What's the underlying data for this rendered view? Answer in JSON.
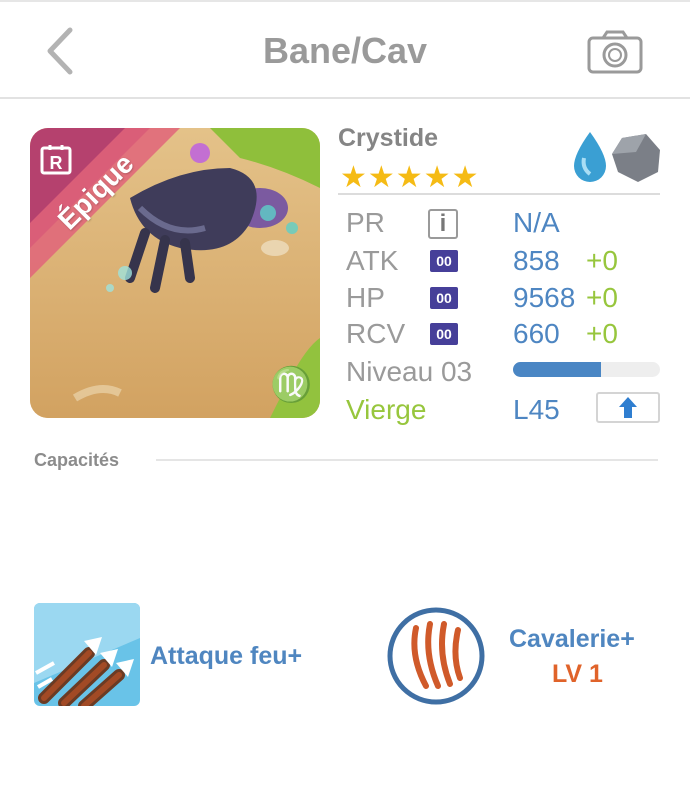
{
  "header": {
    "title": "Bane/Cav",
    "back_icon": "chevron-left-icon",
    "camera_icon": "camera-icon"
  },
  "monster": {
    "rarity_badge": "R",
    "rarity": "Épique",
    "zodiac_glyph": "♍",
    "name": "Crystide",
    "stars": "★★★★★",
    "star_count": 5,
    "elements": [
      "water-icon",
      "rock-icon"
    ]
  },
  "stats": {
    "pr": {
      "label": "PR",
      "value": "N/A",
      "badge": "i"
    },
    "atk": {
      "label": "ATK",
      "badge": "00",
      "value": "858",
      "bonus": "+0"
    },
    "hp": {
      "label": "HP",
      "badge": "00",
      "value": "9568",
      "bonus": "+0"
    },
    "rcv": {
      "label": "RCV",
      "badge": "00",
      "value": "660",
      "bonus": "+0"
    },
    "level": {
      "label": "Niveau 03",
      "progress": 0.6
    },
    "sign": {
      "label": "Vierge",
      "value": "L45"
    }
  },
  "abilities": {
    "section_label": "Capacités",
    "skill": {
      "name": "Attaque feu+",
      "icon": "fire-arrows-icon"
    },
    "leader": {
      "name": "Cavalerie+",
      "level": "LV 1",
      "icon": "claw-marks-icon"
    }
  },
  "colors": {
    "accent_blue": "#4e86c2",
    "bonus_green": "#97c63d",
    "star_yellow": "#f5bb15",
    "level_orange": "#e0632a",
    "badge_purple": "#463f99"
  }
}
